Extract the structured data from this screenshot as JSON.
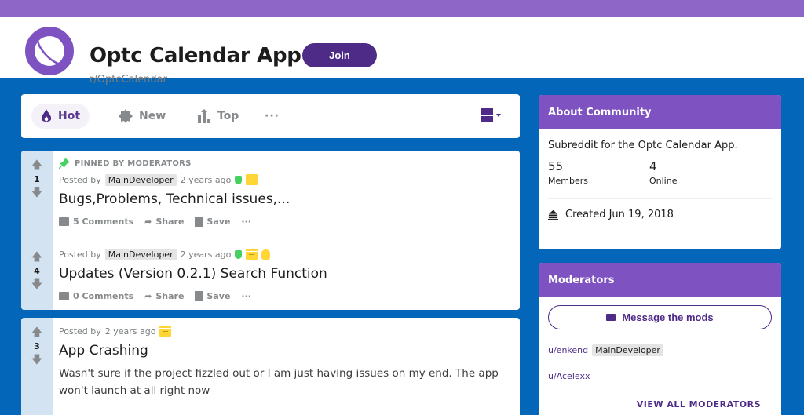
{
  "header": {
    "title": "Optc Calendar App",
    "subreddit": "r/OptcCalendar",
    "join_label": "Join",
    "logo_icon": "planet-icon"
  },
  "sort": {
    "items": [
      {
        "label": "Hot",
        "icon": "flame-icon",
        "active": true
      },
      {
        "label": "New",
        "icon": "burst-icon",
        "active": false
      },
      {
        "label": "Top",
        "icon": "bar-chart-icon",
        "active": false
      }
    ],
    "more_label": "···",
    "view_icon": "card-view-icon"
  },
  "posts": [
    {
      "pinned_label": "PINNED BY MODERATORS",
      "votes": "1",
      "posted_by": "Posted by",
      "author_flair": "MainDeveloper",
      "time": "2 years ago",
      "title": "Bugs,Problems, Technical issues,...",
      "comments": "5 Comments",
      "share": "Share",
      "save": "Save",
      "more": "···"
    },
    {
      "votes": "4",
      "posted_by": "Posted by",
      "author_flair": "MainDeveloper",
      "time": "2 years ago",
      "title": "Updates (Version 0.2.1) Search Function",
      "comments": "0 Comments",
      "share": "Share",
      "save": "Save",
      "more": "···"
    },
    {
      "votes": "3",
      "posted_by": "Posted by",
      "time": "2 years ago",
      "title": "App Crashing",
      "text": "Wasn't sure if the project fizzled out or I am just having issues on my end. The app won't launch at all right now"
    }
  ],
  "about": {
    "heading": "About Community",
    "description": "Subreddit for the Optc Calendar App.",
    "members_count": "55",
    "members_label": "Members",
    "online_count": "4",
    "online_label": "Online",
    "created": "Created Jun 19, 2018"
  },
  "moderators": {
    "heading": "Moderators",
    "message_label": "Message the mods",
    "list": [
      {
        "user": "u/enkend",
        "flair": "MainDeveloper"
      },
      {
        "user": "u/Acelexx"
      }
    ],
    "view_all_label": "VIEW ALL MODERATORS"
  },
  "colors": {
    "banner": "#8e66c8",
    "accent": "#4f2b88",
    "card_header": "#7e53c1",
    "background": "#0366b8"
  }
}
